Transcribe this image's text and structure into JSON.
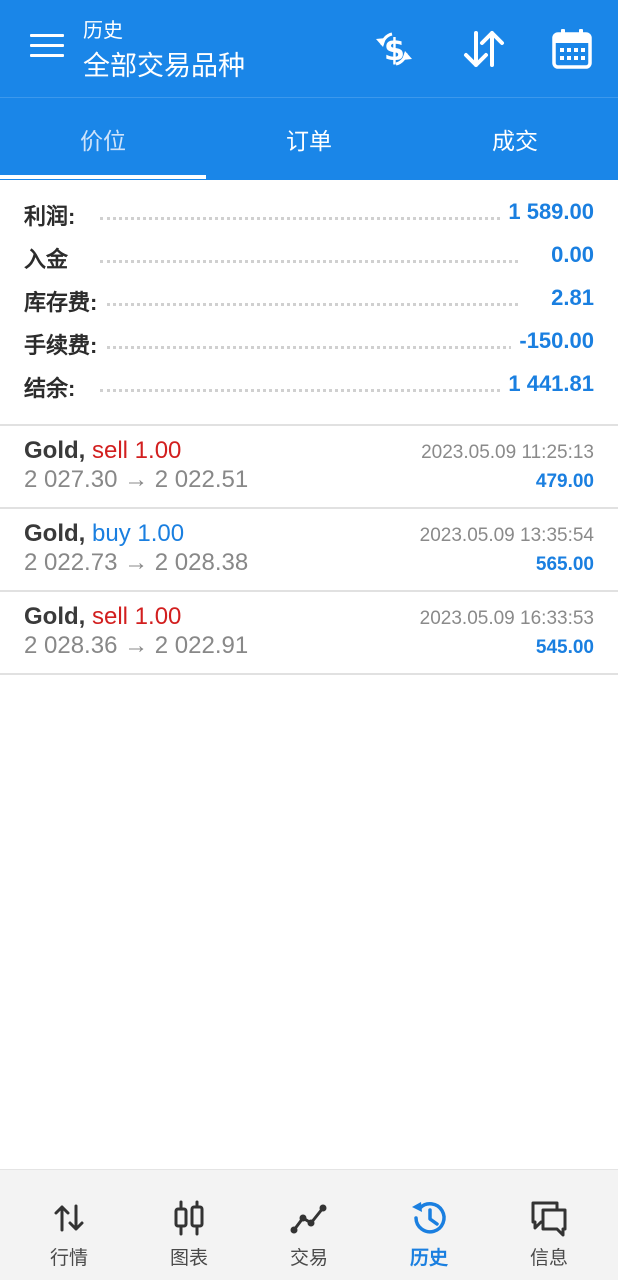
{
  "header": {
    "subtitle": "历史",
    "title": "全部交易品种",
    "actions": [
      "currency-exchange-icon",
      "sort-icon",
      "calendar-icon"
    ]
  },
  "tabs": [
    {
      "label": "价位",
      "active": true
    },
    {
      "label": "订单",
      "active": false
    },
    {
      "label": "成交",
      "active": false
    }
  ],
  "summary": [
    {
      "label": "利润:",
      "value": "1 589.00"
    },
    {
      "label": "入金",
      "value": "0.00"
    },
    {
      "label": "库存费:",
      "value": "2.81"
    },
    {
      "label": "手续费:",
      "value": "-150.00"
    },
    {
      "label": "结余:",
      "value": "1 441.81"
    }
  ],
  "deals": [
    {
      "symbol": "Gold,",
      "side": "sell 1.00",
      "side_type": "sell",
      "prices": "2 027.30 → 2 022.51",
      "time": "2023.05.09 11:25:13",
      "profit": "479.00"
    },
    {
      "symbol": "Gold,",
      "side": "buy 1.00",
      "side_type": "buy",
      "prices": "2 022.73 → 2 028.38",
      "time": "2023.05.09 13:35:54",
      "profit": "565.00"
    },
    {
      "symbol": "Gold,",
      "side": "sell 1.00",
      "side_type": "sell",
      "prices": "2 028.36 → 2 022.91",
      "time": "2023.05.09 16:33:53",
      "profit": "545.00"
    }
  ],
  "bottom_nav": [
    {
      "label": "行情",
      "icon": "quotes-icon",
      "active": false
    },
    {
      "label": "图表",
      "icon": "chart-icon",
      "active": false
    },
    {
      "label": "交易",
      "icon": "trade-icon",
      "active": false
    },
    {
      "label": "历史",
      "icon": "history-icon",
      "active": true
    },
    {
      "label": "信息",
      "icon": "messages-icon",
      "active": false
    }
  ],
  "colors": {
    "primary": "#1a86e8",
    "sell": "#d21f1f",
    "buy": "#1a7fe0",
    "value": "#1a7fe0"
  }
}
